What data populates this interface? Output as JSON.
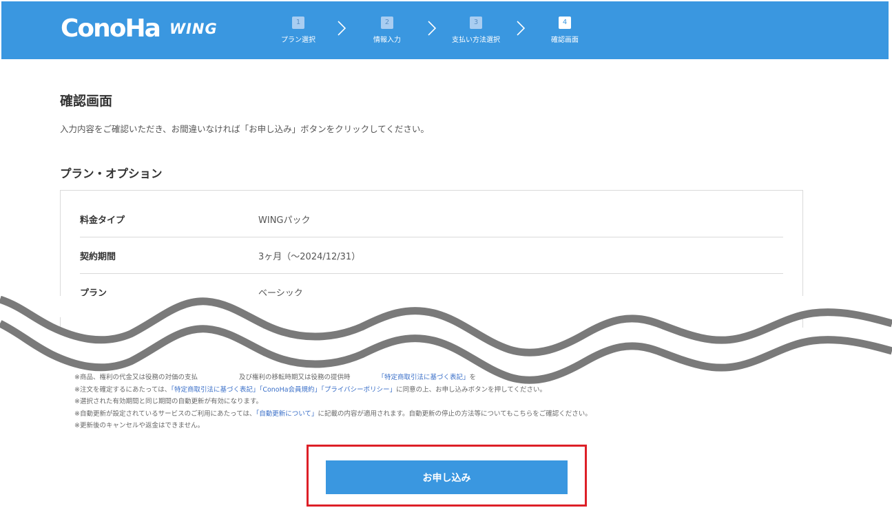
{
  "header": {
    "logo_main": "ConoHa",
    "logo_sub": "WING",
    "steps": [
      {
        "num": "1",
        "label": "プラン選択"
      },
      {
        "num": "2",
        "label": "情報入力"
      },
      {
        "num": "3",
        "label": "支払い方法選択"
      },
      {
        "num": "4",
        "label": "確認画面"
      }
    ]
  },
  "main": {
    "title": "確認画面",
    "intro": "入力内容をご確認いただき、お間違いなければ「お申し込み」ボタンをクリックしてください。",
    "section_title": "プラン・オプション",
    "plan_rows": [
      {
        "label": "料金タイプ",
        "value": "WINGパック"
      },
      {
        "label": "契約期間",
        "value": "3ヶ月（～2024/12/31）"
      },
      {
        "label": "プラン",
        "value": "ベーシック"
      }
    ]
  },
  "notes": {
    "line1_pre": "※商品、権利の代金又は役務の対価の支払",
    "line1_mid": "及び権利の移転時期又は役務の提供時",
    "line1_link": "「特定商取引法に基づく表記」",
    "line1_post": "を",
    "line2_pre": "※注文を確定するにあたっては、",
    "line2_link1": "「特定商取引法に基づく表記」",
    "line2_link2": "「ConoHa会員規約」",
    "line2_link3": "「プライバシーポリシー」",
    "line2_post": "に同意の上、お申し込みボタンを押してください。",
    "line3": "※選択された有効期間と同じ期間の自動更新が有効になります。",
    "line4_pre": "※自動更新が設定されているサービスのご利用にあたっては、",
    "line4_link": "「自動更新について」",
    "line4_post": "に記載の内容が適用されます。自動更新の停止の方法等についてもこちらをご確認ください。",
    "line5": "※更新後のキャンセルや返金はできません。"
  },
  "submit": {
    "label": "お申し込み"
  },
  "colors": {
    "brand": "#3a97e0",
    "highlight": "#dd1f27",
    "link": "#3a6fc8",
    "wave": "#7a7a7a"
  }
}
